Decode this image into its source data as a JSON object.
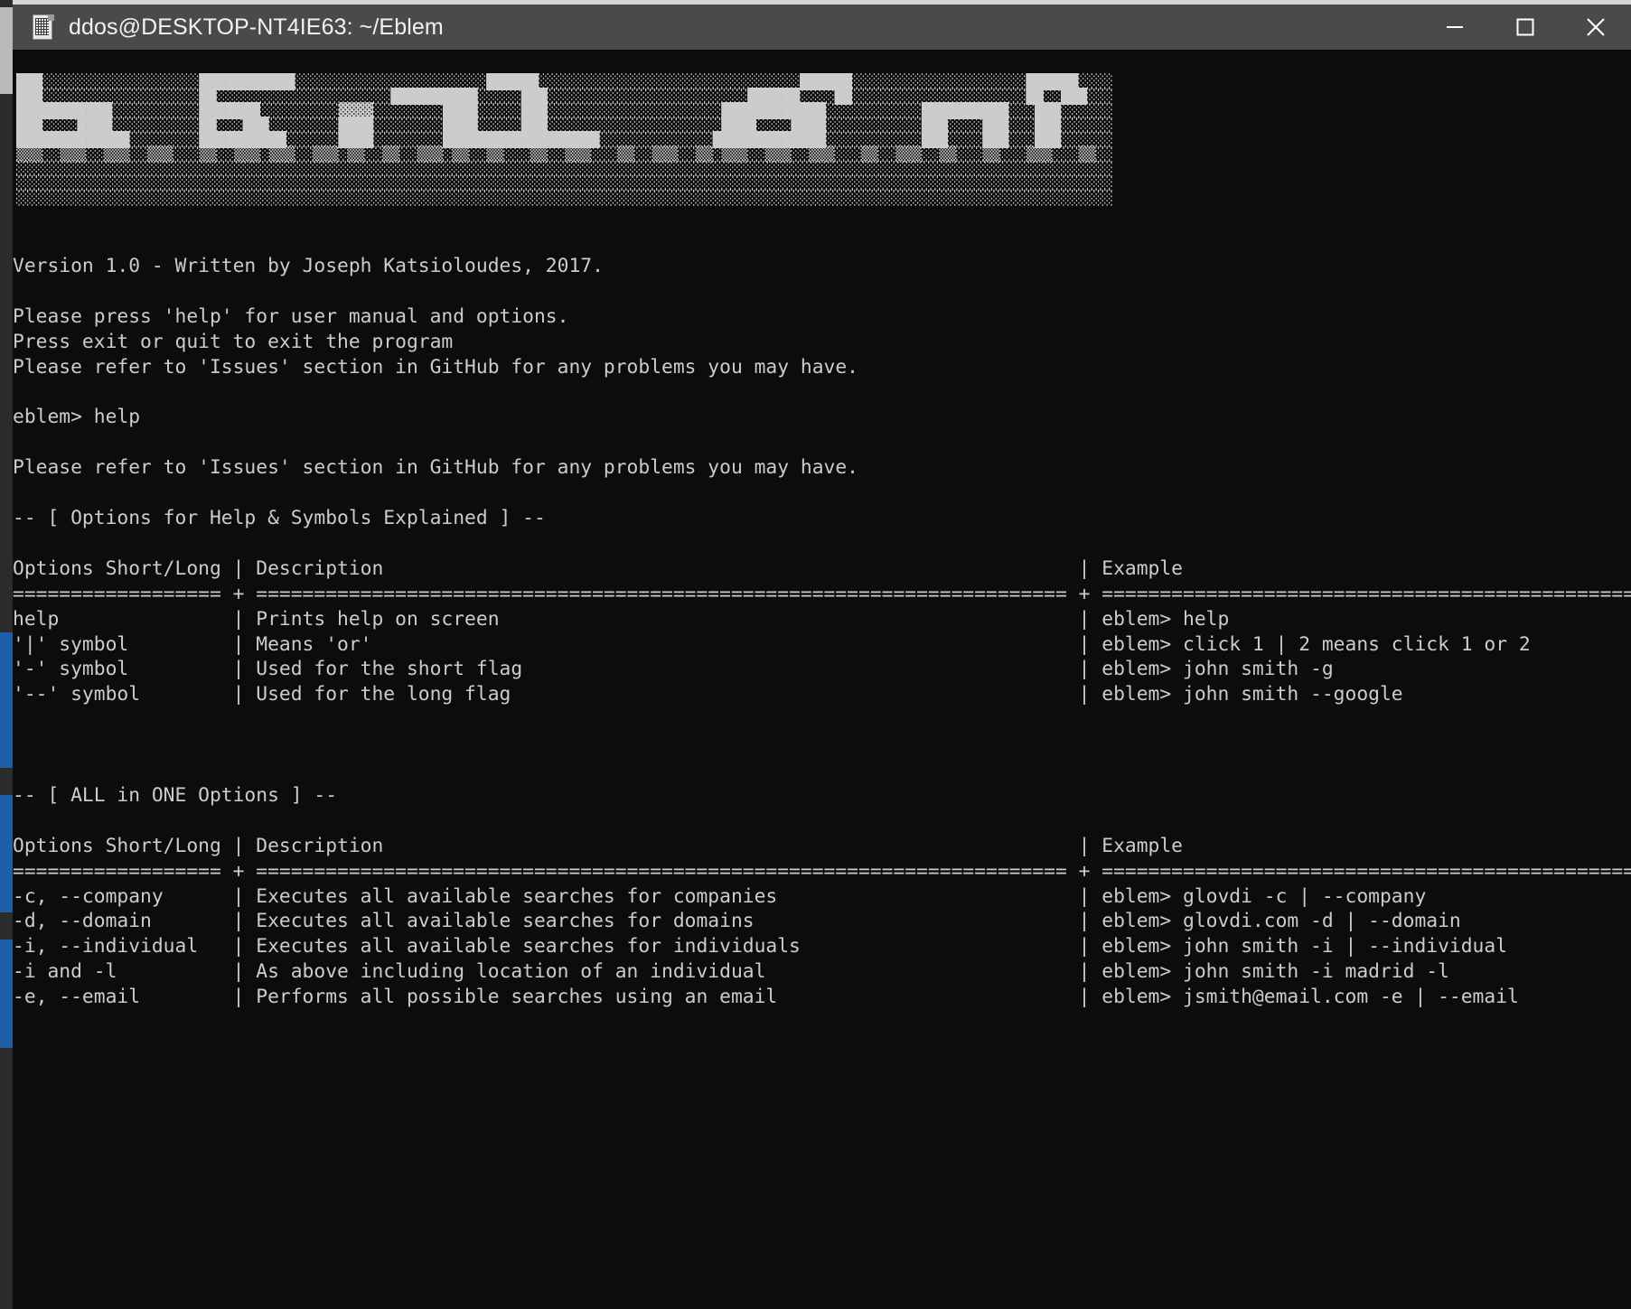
{
  "window": {
    "title": "ddos@DESKTOP-NT4IE63: ~/Eblem",
    "icon": "terminal-app-icon",
    "controls": {
      "minimize_label": "Minimize",
      "maximize_label": "Maximize",
      "close_label": "Close"
    },
    "titlebar_color": "#4c4a48",
    "background_color": "#0c0c0c",
    "foreground_color": "#cccccc"
  },
  "terminal": {
    "banner_art": [
      "███░░░░░░░░░░░░░░░░░░███████████░░░░░░░░░░░░░░░░░░░░░░██████░░░░░░░░░░░░░░░░░░░░░░░░░░░░░░██████░░░░░░░░░░░░░░░░░░░░██████░░░░",
      "███░░░░░░░░░░░░░░░░░░██░░░░░░░░░░░░░░░░░░░░██████████░░░░░███░░░░░░░░░░░░░░░░░░░░░░░██████░░░░██░░░░░░░░░░░░░░░░░░░░██░░███░░░",
      "███████████░░░░░░░░░░███████░░░░░░░░░▓▓▓▓░░░░░░░░████░░░░░███░░░░░░░░░░░░░░░░░░░░████████████░░░░░░░░░░░██████████░░░███░░░░░░",
      "███░░░░████░░░░░░░░░░██░░░███░░░░░░░░████░░░░░░░░████░░░░░███░░░░░░░░░░░░░░░░░░░░████░░░░████░░░░░░░░░░░███░░░░███░░░███░░░░░░",
      "█████████████░░░░░░░░██████████░░░░░░████░░░░░░░░██████████████████░░░░░░░░░░░░░█████████████░░░░░░░░░░░███░░░░███░░░███░░░░░░",
      "▒▒▒░░▒▒▒░░▒▒▒░░▒▒▒░░░▒▒░░▒▒▒░▒▒▒░░▒▒▒░▒▒░░▒▒░░▒▒▒░▒▒░░▒▒░░░▒▒░░▒▒▒░░░▒▒░░▒▒▒░░▒▒░▒▒▒░░▒▒▒░░▒▒▒░░░▒▒░░▒▒▒░░▒▒░░░▒▒░░░▒▒▒░░░▒▒░░",
      "░░░░░░░░░░░░░░░░░░░░░░░░░░░░░░░░░░░░░░░░░░░░░░░░░░░░░░░░░░░░░░░░░░░░░░░░░░░░░░░░░░░░░░░░░░░░░░░░░░░░░░░░░░░░░░░░░░░░░░░░░░░░░░",
      "░░░░░░░░░░░░░░░░░░░░░░░░░░░░░░░░░░░░░░░░░░░░░░░░░░░░░░░░░░░░░░░░░░░░░░░░░░░░░░░░░░░░░░░░░░░░░░░░░░░░░░░░░░░░░░░░░░░░░░░░░░░░░░",
      "░░░░░░░░░░░░░░░░░░░░░░░░░░░░░░░░░░░░░░░░░░░░░░░░░░░░░░░░░░░░░░░░░░░░░░░░░░░░░░░░░░░░░░░░░░░░░░░░░░░░░░░░░░░░░░░░░░░░░░░░░░░░░░"
    ],
    "banner_word": "EBLEM",
    "version_line": "Version 1.0 - Written by Joseph Katsioloudes, 2017.",
    "intro_lines": [
      "Please press 'help' for user manual and options.",
      "Press exit or quit to exit the program",
      "Please refer to 'Issues' section in GitHub for any problems you may have."
    ],
    "prompt": {
      "symbol": "eblem>",
      "command": "help",
      "full": "eblem> help"
    },
    "issues_line": "Please refer to 'Issues' section in GitHub for any problems you may have.",
    "sections": [
      {
        "heading": "-- [ Options for Help & Symbols Explained ] --",
        "headers": [
          "Options Short/Long",
          "Description",
          "Example"
        ],
        "separator": "================== + ======================================================= + =========================================================",
        "rows": [
          {
            "option": "help",
            "description": "Prints help on screen",
            "example": "eblem> help"
          },
          {
            "option": "'|' symbol",
            "description": "Means 'or'",
            "example": "eblem> click 1 | 2 means click 1 or 2"
          },
          {
            "option": "'-' symbol",
            "description": "Used for the short flag",
            "example": "eblem> john smith -g"
          },
          {
            "option": "'--' symbol",
            "description": "Used for the long flag",
            "example": "eblem> john smith --google"
          }
        ]
      },
      {
        "heading": "-- [ ALL in ONE Options ] --",
        "headers": [
          "Options Short/Long",
          "Description",
          "Example"
        ],
        "separator": "================== + ======================================================= + =========================================================",
        "rows": [
          {
            "option": "-c, --company",
            "description": "Executes all available searches for companies",
            "example": "eblem> glovdi -c | --company"
          },
          {
            "option": "-d, --domain",
            "description": "Executes all available searches for domains",
            "example": "eblem> glovdi.com -d | --domain"
          },
          {
            "option": "-i, --individual",
            "description": "Executes all available searches for individuals",
            "example": "eblem> john smith -i | --individual"
          },
          {
            "option": "-i and -l",
            "description": "As above including location of an individual",
            "example": "eblem> john smith -i madrid -l"
          },
          {
            "option": "-e, --email",
            "description": "Performs all possible searches using an email",
            "example": "eblem> jsmith@email.com -e | --email"
          }
        ]
      }
    ]
  }
}
